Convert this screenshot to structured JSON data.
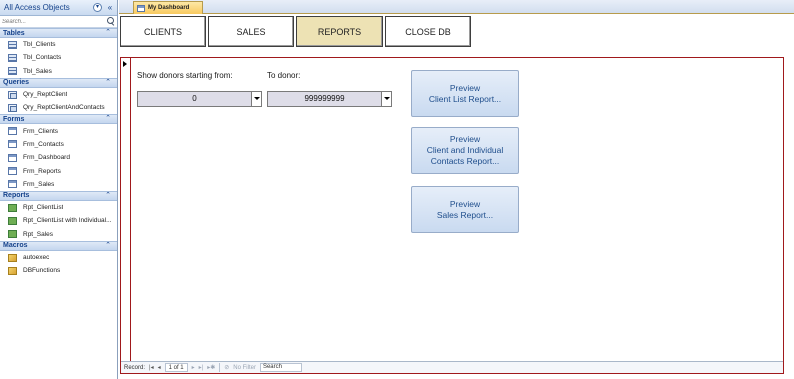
{
  "nav": {
    "title": "All Access Objects",
    "search_placeholder": "Search...",
    "groups": [
      {
        "name": "Tables",
        "items": [
          "Tbl_Clients",
          "Tbl_Contacts",
          "Tbl_Sales"
        ],
        "icon": "table-icon"
      },
      {
        "name": "Queries",
        "items": [
          "Qry_ReptClient",
          "Qry_ReptClientAndContacts"
        ],
        "icon": "query-icon"
      },
      {
        "name": "Forms",
        "items": [
          "Frm_Clients",
          "Frm_Contacts",
          "Frm_Dashboard",
          "Frm_Reports",
          "Frm_Sales"
        ],
        "icon": "form-icon"
      },
      {
        "name": "Reports",
        "items": [
          "Rpt_ClientList",
          "Rpt_ClientList with Individual...",
          "Rpt_Sales"
        ],
        "icon": "report-icon"
      },
      {
        "name": "Macros",
        "items": [
          "autoexec",
          "DBFunctions"
        ],
        "icon": "macro-icon"
      }
    ]
  },
  "document": {
    "tab_label": "My Dashboard"
  },
  "dashboard": {
    "buttons": {
      "clients": "CLIENTS",
      "sales": "SALES",
      "reports": "REPORTS",
      "close": "CLOSE DB"
    },
    "active_button": "reports",
    "from_label": "Show donors starting from:",
    "to_label": "To donor:",
    "from_value": "0",
    "to_value": "999999999",
    "preview_buttons": [
      [
        "Preview",
        "Client List Report..."
      ],
      [
        "Preview",
        "Client and Individual",
        "Contacts Report..."
      ],
      [
        "Preview",
        "Sales Report..."
      ]
    ]
  },
  "record_nav": {
    "label": "Record:",
    "position": "1 of 1",
    "filter": "No Filter",
    "search": "Search"
  },
  "colors": {
    "accent_border": "#a0191c",
    "active_tab": "#f8c95f",
    "active_button": "#ede2b4",
    "preview_text": "#1f4e8c"
  }
}
